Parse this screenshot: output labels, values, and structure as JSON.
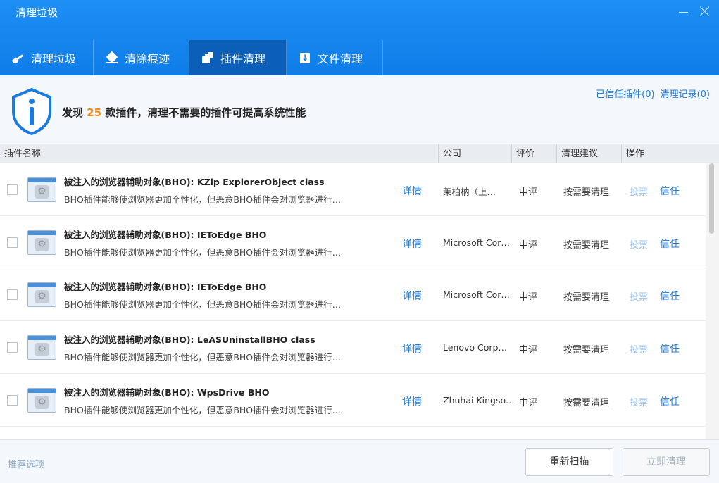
{
  "window": {
    "title": "清理垃圾"
  },
  "tabs": [
    {
      "label": "清理垃圾",
      "icon": "broom-icon"
    },
    {
      "label": "清除痕迹",
      "icon": "eraser-icon"
    },
    {
      "label": "插件清理",
      "icon": "plugin-icon"
    },
    {
      "label": "文件清理",
      "icon": "file-icon"
    }
  ],
  "info": {
    "prefix": "发现",
    "count": "25",
    "suffix": "款插件，清理不需要的插件可提高系统性能",
    "trusted_link": "已信任插件(0)",
    "records_link": "清理记录(0)"
  },
  "columns": {
    "name": "插件名称",
    "company": "公司",
    "rating": "评价",
    "advice": "清理建议",
    "action": "操作"
  },
  "rows": [
    {
      "title": "被注入的浏览器辅助对象(BHO): KZip ExplorerObject class",
      "desc": "BHO插件能够使浏览器更加个性化，但恶意BHO插件会对浏览器进行…",
      "detail": "详情",
      "company": "茉柏枘（上…",
      "rating": "中评",
      "advice": "按需要清理",
      "vote": "投票",
      "trust": "信任"
    },
    {
      "title": "被注入的浏览器辅助对象(BHO): IEToEdge BHO",
      "desc": "BHO插件能够使浏览器更加个性化，但恶意BHO插件会对浏览器进行…",
      "detail": "详情",
      "company": "Microsoft Cor…",
      "rating": "中评",
      "advice": "按需要清理",
      "vote": "投票",
      "trust": "信任"
    },
    {
      "title": "被注入的浏览器辅助对象(BHO): IEToEdge BHO",
      "desc": "BHO插件能够使浏览器更加个性化，但恶意BHO插件会对浏览器进行…",
      "detail": "详情",
      "company": "Microsoft Cor…",
      "rating": "中评",
      "advice": "按需要清理",
      "vote": "投票",
      "trust": "信任"
    },
    {
      "title": "被注入的浏览器辅助对象(BHO): LeASUninstallBHO class",
      "desc": "BHO插件能够使浏览器更加个性化，但恶意BHO插件会对浏览器进行…",
      "detail": "详情",
      "company": "Lenovo Corp…",
      "rating": "中评",
      "advice": "按需要清理",
      "vote": "投票",
      "trust": "信任"
    },
    {
      "title": "被注入的浏览器辅助对象(BHO): WpsDrive BHO",
      "desc": "BHO插件能够使浏览器更加个性化，但恶意BHO插件会对浏览器进行…",
      "detail": "详情",
      "company": "Zhuhai Kingso…",
      "rating": "中评",
      "advice": "按需要清理",
      "vote": "投票",
      "trust": "信任"
    }
  ],
  "footer": {
    "recommend": "推荐选项",
    "rescan": "重新扫描",
    "clean_now": "立即清理"
  },
  "colors": {
    "header_blue": "#0f7de8",
    "active_tab": "#0b5fb8",
    "link_blue": "#1a7ae0",
    "count_orange": "#f08a1c"
  }
}
